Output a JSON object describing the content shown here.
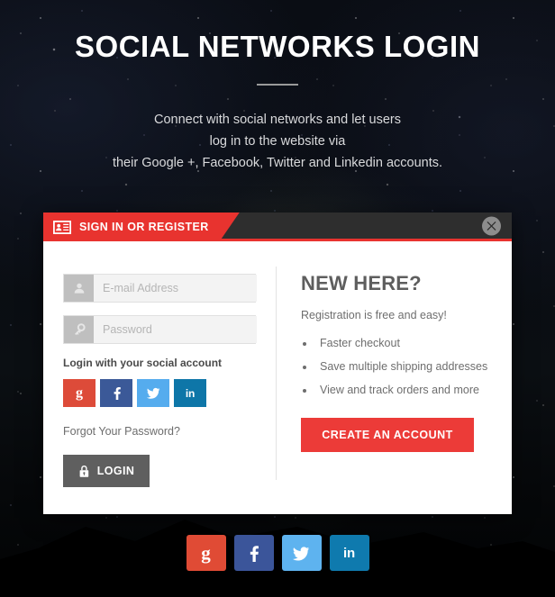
{
  "hero": {
    "title": "SOCIAL NETWORKS LOGIN",
    "line1": "Connect with social networks and let users",
    "line2": "log in to the website via",
    "line3": "their Google +, Facebook, Twitter and Linkedin accounts."
  },
  "modal": {
    "tab_label": "SIGN IN OR REGISTER",
    "tab_icon": "vcard-icon",
    "close_icon": "close-icon",
    "accent_color": "#e8332f",
    "header_color": "#2e2e2e"
  },
  "login": {
    "email": {
      "icon": "user-icon",
      "placeholder": "E-mail Address",
      "value": ""
    },
    "password": {
      "icon": "key-icon",
      "placeholder": "Password",
      "value": ""
    },
    "social_label": "Login with your social account",
    "social_buttons": [
      {
        "name": "google-plus",
        "glyph": "g",
        "color": "#dd4b39"
      },
      {
        "name": "facebook",
        "glyph": "f",
        "color": "#3b5998"
      },
      {
        "name": "twitter",
        "glyph": "twitter-bird",
        "color": "#55acee"
      },
      {
        "name": "linkedin",
        "glyph": "in",
        "color": "#0e76a8"
      }
    ],
    "forgot_label": "Forgot Your Password?",
    "login_label": "LOGIN",
    "login_icon": "lock-icon"
  },
  "register": {
    "title": "NEW HERE?",
    "subtitle": "Registration is free and easy!",
    "benefits": [
      "Faster checkout",
      "Save multiple shipping addresses",
      "View and track orders and more"
    ],
    "cta_label": "CREATE AN ACCOUNT",
    "cta_color": "#ec3b38"
  },
  "footer_social": [
    {
      "name": "google-plus",
      "glyph": "g",
      "color": "#e04b35"
    },
    {
      "name": "facebook",
      "glyph": "f",
      "color": "#3b559a"
    },
    {
      "name": "twitter",
      "glyph": "twitter-bird",
      "color": "#5eb3ef"
    },
    {
      "name": "linkedin",
      "glyph": "in",
      "color": "#0f7aae"
    }
  ]
}
